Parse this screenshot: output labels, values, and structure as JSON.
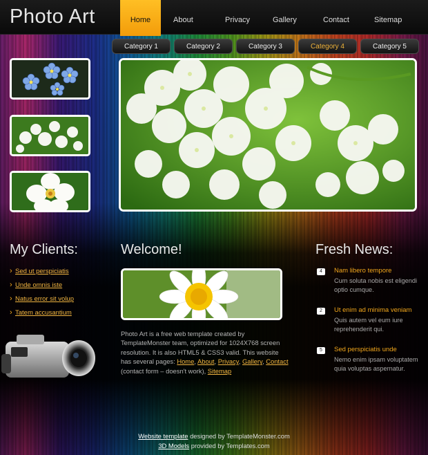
{
  "site": {
    "logo": "Photo Art"
  },
  "nav": {
    "items": [
      {
        "label": "Home",
        "active": true
      },
      {
        "label": "About"
      },
      {
        "label": "Privacy"
      },
      {
        "label": "Gallery"
      },
      {
        "label": "Contact"
      },
      {
        "label": "Sitemap"
      }
    ]
  },
  "categories": [
    "Category 1",
    "Category 2",
    "Category 3",
    "Category 4",
    "Category 5"
  ],
  "categories_active": "Category 4",
  "clients": {
    "heading": "My Clients:",
    "links": [
      "Sed ut perspiciatis",
      "Unde omnis iste",
      "Natus error sit volup",
      "Tatem accusantium"
    ]
  },
  "welcome": {
    "heading": "Welcome!",
    "intro": "Photo Art is a free web template created by TemplateMonster team, optimized for 1024X768 screen resolution. It is also HTML5 & CSS3 valid. This website has several pages: ",
    "links": [
      "Home",
      "About",
      "Privacy",
      "Gallery",
      "Contact",
      "Sitemap"
    ],
    "contact_note": " (contact form – doesn't work), "
  },
  "news": {
    "heading": "Fresh News:",
    "items": [
      {
        "num": "4",
        "title": "Nam libero tempore",
        "body": "Cum soluta nobis est eligendi optio cumque."
      },
      {
        "num": "2",
        "title": "Ut enim ad minima veniam",
        "body": "Quis autem vel eum iure reprehenderit qui."
      },
      {
        "num": "5",
        "title": "Sed perspiciatis unde",
        "body": "Nemo enim ipsam voluptatem quia voluptas aspernatur."
      }
    ]
  },
  "footer": {
    "line1_link": "Website template",
    "line1_text": " designed by TemplateMonster.com",
    "line2_link": "3D Models",
    "line2_text": " provided by Templates.com"
  },
  "colors": {
    "accent": "#f2a71c",
    "nav_active": "#f7ad16",
    "link": "#f2b641"
  }
}
